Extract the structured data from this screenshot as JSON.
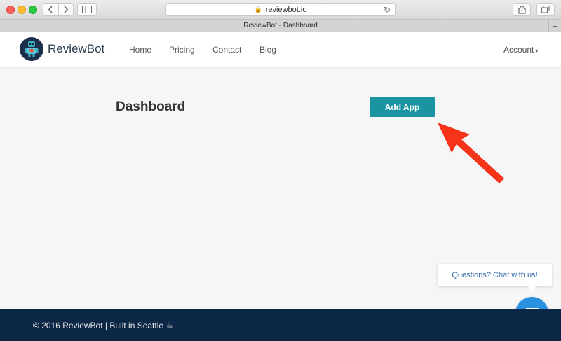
{
  "browser": {
    "url": "reviewbot.io",
    "tab_title": "ReviewBot - Dashboard",
    "icons": [
      "back-icon",
      "forward-icon",
      "sidebar-icon",
      "lock-icon",
      "reload-icon",
      "share-icon",
      "tabs-icon",
      "new-tab-icon"
    ]
  },
  "nav": {
    "brand": "ReviewBot",
    "links": [
      "Home",
      "Pricing",
      "Contact",
      "Blog"
    ],
    "account": "Account"
  },
  "main": {
    "title": "Dashboard",
    "add_app_label": "Add App"
  },
  "chat": {
    "prompt": "Questions? Chat with us!"
  },
  "footer": {
    "text": "© 2016 ReviewBot | Built in Seattle ☕"
  },
  "colors": {
    "accent": "#1a94a0",
    "footer_bg": "#0c2645",
    "chat_button": "#2a91e0",
    "annotation_arrow": "#f5341a"
  }
}
